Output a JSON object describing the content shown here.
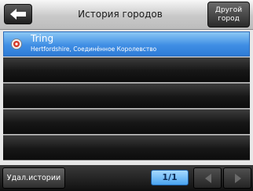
{
  "header": {
    "back_icon": "arrow-left-icon",
    "title": "История городов",
    "other_city_label": "Другой\nгород"
  },
  "list": {
    "items": [
      {
        "name": "Tring",
        "detail": "Hertfordshire, Соединённое Королевство",
        "icon": "location-pin-icon",
        "selected": true
      }
    ],
    "empty_rows": 5
  },
  "footer": {
    "delete_label": "Удал.истории",
    "page_indicator": "1/1",
    "prev_icon": "triangle-left-icon",
    "next_icon": "triangle-right-icon"
  },
  "colors": {
    "selection": "#3f8ee4",
    "row_dark": "#171717",
    "accent_pin": "#d63a2a"
  }
}
